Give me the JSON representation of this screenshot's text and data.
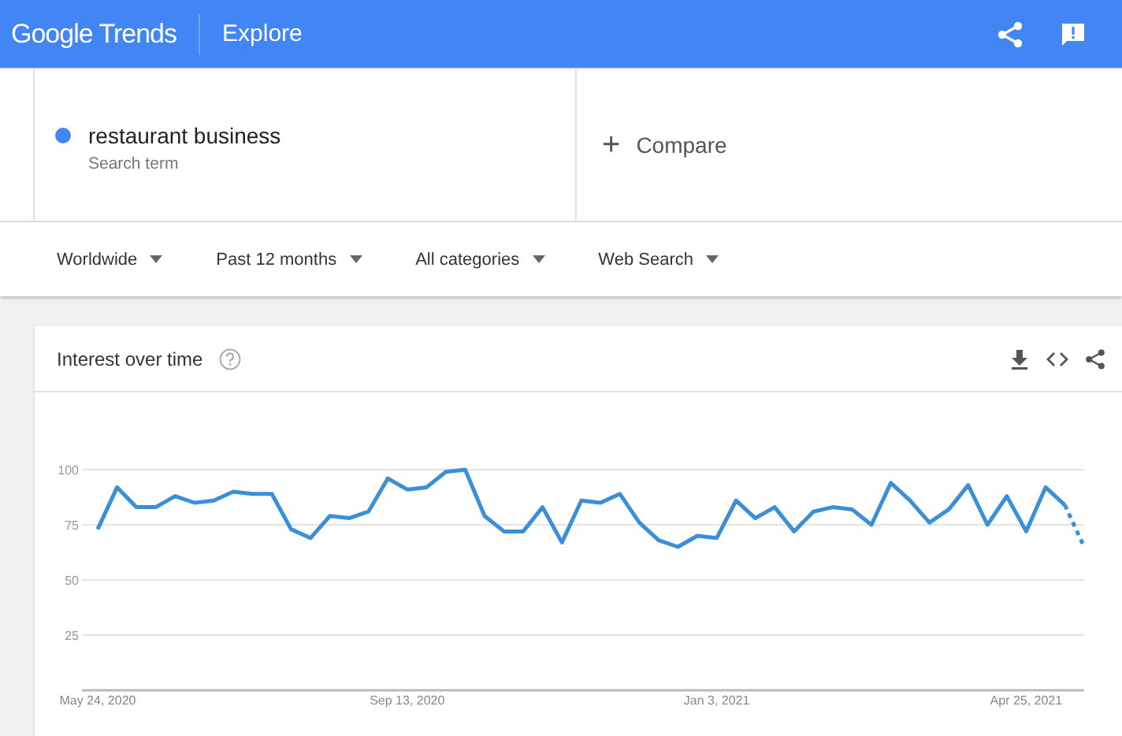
{
  "header": {
    "logo": "Google Trends",
    "title": "Explore"
  },
  "search_terms": [
    {
      "term": "restaurant business",
      "caption": "Search term",
      "color": "#4285f4"
    }
  ],
  "compare": {
    "label": "Compare",
    "icon": "+"
  },
  "filters": [
    {
      "label": "Worldwide"
    },
    {
      "label": "Past 12 months"
    },
    {
      "label": "All categories"
    },
    {
      "label": "Web Search"
    }
  ],
  "interest_card": {
    "title": "Interest over time",
    "chart_data": {
      "type": "line",
      "categories": [
        "May 24, 2020",
        null,
        null,
        null,
        null,
        null,
        null,
        null,
        null,
        null,
        null,
        null,
        null,
        null,
        null,
        null,
        "Sep 13, 2020",
        null,
        null,
        null,
        null,
        null,
        null,
        null,
        null,
        null,
        null,
        null,
        null,
        null,
        null,
        null,
        "Jan 3, 2021",
        null,
        null,
        null,
        null,
        null,
        null,
        null,
        null,
        null,
        null,
        null,
        null,
        null,
        null,
        null,
        "Apr 25, 2021",
        null,
        null,
        null
      ],
      "ylim": [
        0,
        100
      ],
      "grid": true,
      "yticks": [
        25,
        50,
        75,
        100
      ],
      "series": [
        {
          "color": "#3a8fd8",
          "values": [
            73,
            92,
            83,
            83,
            88,
            85,
            86,
            90,
            89,
            89,
            73,
            69,
            79,
            78,
            81,
            96,
            91,
            92,
            99,
            100,
            79,
            72,
            72,
            83,
            67,
            86,
            85,
            89,
            76,
            68,
            65,
            70,
            69,
            86,
            78,
            83,
            72,
            81,
            83,
            82,
            75,
            94,
            86,
            76,
            82,
            93,
            75,
            88,
            72,
            92,
            84,
            65
          ]
        }
      ]
    }
  }
}
